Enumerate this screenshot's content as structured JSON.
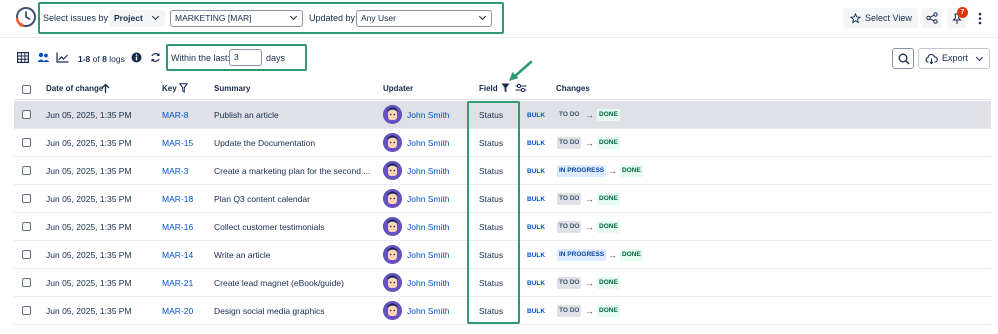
{
  "topbar": {
    "select_issues_label": "Select issues by:",
    "project_select": "Project",
    "project_value": "MARKETING [MAR]",
    "updated_by_label": "Updated by:",
    "updated_by_value": "Any User",
    "select_view_label": "Select View",
    "notifications_count": "7"
  },
  "toolbar": {
    "count_prefix": "1-8",
    "count_of": "of",
    "count_total": "8",
    "count_suffix": "logs",
    "within_label": "Within the last:",
    "days_value": "3",
    "days_label": "days",
    "export_label": "Export"
  },
  "table": {
    "headers": {
      "date": "Date of change",
      "key": "Key",
      "summary": "Summary",
      "updater": "Updater",
      "field": "Field",
      "changes": "Changes"
    },
    "rows": [
      {
        "date": "Jun 05, 2025, 1:35 PM",
        "key": "MAR-8",
        "summary": "Publish an article",
        "updater": "John Smith",
        "field": "Status",
        "bulk": "BULK",
        "from": "TO DO",
        "to": "DONE",
        "highlighted": true
      },
      {
        "date": "Jun 05, 2025, 1:35 PM",
        "key": "MAR-15",
        "summary": "Update the Documentation",
        "updater": "John Smith",
        "field": "Status",
        "bulk": "BULK",
        "from": "TO DO",
        "to": "DONE"
      },
      {
        "date": "Jun 05, 2025, 1:35 PM",
        "key": "MAR-3",
        "summary": "Create a marketing plan for the second ...",
        "updater": "John Smith",
        "field": "Status",
        "bulk": "BULK",
        "from": "IN PROGRESS",
        "to": "DONE"
      },
      {
        "date": "Jun 05, 2025, 1:35 PM",
        "key": "MAR-18",
        "summary": "Plan Q3 content calendar",
        "updater": "John Smith",
        "field": "Status",
        "bulk": "BULK",
        "from": "TO DO",
        "to": "DONE"
      },
      {
        "date": "Jun 05, 2025, 1:35 PM",
        "key": "MAR-16",
        "summary": "Collect customer testimonials",
        "updater": "John Smith",
        "field": "Status",
        "bulk": "BULK",
        "from": "TO DO",
        "to": "DONE"
      },
      {
        "date": "Jun 05, 2025, 1:35 PM",
        "key": "MAR-14",
        "summary": "Write an article",
        "updater": "John Smith",
        "field": "Status",
        "bulk": "BULK",
        "from": "IN PROGRESS",
        "to": "DONE"
      },
      {
        "date": "Jun 05, 2025, 1:35 PM",
        "key": "MAR-21",
        "summary": "Create lead magnet (eBook/guide)",
        "updater": "John Smith",
        "field": "Status",
        "bulk": "BULK",
        "from": "TO DO",
        "to": "DONE"
      },
      {
        "date": "Jun 05, 2025, 1:35 PM",
        "key": "MAR-20",
        "summary": "Design social media graphics",
        "updater": "John Smith",
        "field": "Status",
        "bulk": "BULK",
        "from": "TO DO",
        "to": "DONE"
      }
    ]
  },
  "colors": {
    "highlight_border": "#2e9a72",
    "link": "#0052cc",
    "badge": "#de350b",
    "row_highlight": "#dfe1e6"
  }
}
